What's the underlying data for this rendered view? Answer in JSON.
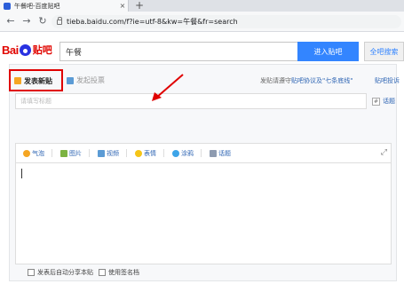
{
  "browser": {
    "tab_title": "午餐吧-百度贴吧",
    "tab_close_label": "×",
    "new_tab_label": "+",
    "url": "tieba.baidu.com/f?ie=utf-8&kw=午餐&fr=search"
  },
  "header": {
    "logo_bai": "Bai",
    "logo_tieba": "贴吧",
    "search_value": "午餐",
    "enter_button": "进入贴吧",
    "all_search_button": "全吧搜索"
  },
  "post": {
    "tab_post": "发表新贴",
    "tab_vote": "发起投票",
    "rules_prefix": "发贴请遵守",
    "rules_link": "贴吧协议及\"七条底线\"",
    "feedback": "贴吧投诉",
    "title_placeholder": "请填写标题",
    "topic_label": "话题",
    "toolbar": [
      {
        "label": "气泡",
        "color": "#f5a623"
      },
      {
        "label": "图片",
        "color": "#7cb342"
      },
      {
        "label": "视频",
        "color": "#5b9bd5"
      },
      {
        "label": "表情",
        "color": "#f5c518"
      },
      {
        "label": "涂鸦",
        "color": "#3da4e8"
      },
      {
        "label": "话题",
        "color": "#8e9bb0"
      }
    ],
    "option_share": "发表后自动分享本贴",
    "option_signature": "使用签名档"
  },
  "colors": {
    "accent": "#3385ff",
    "highlight": "#e00000",
    "link": "#2d64b3"
  }
}
